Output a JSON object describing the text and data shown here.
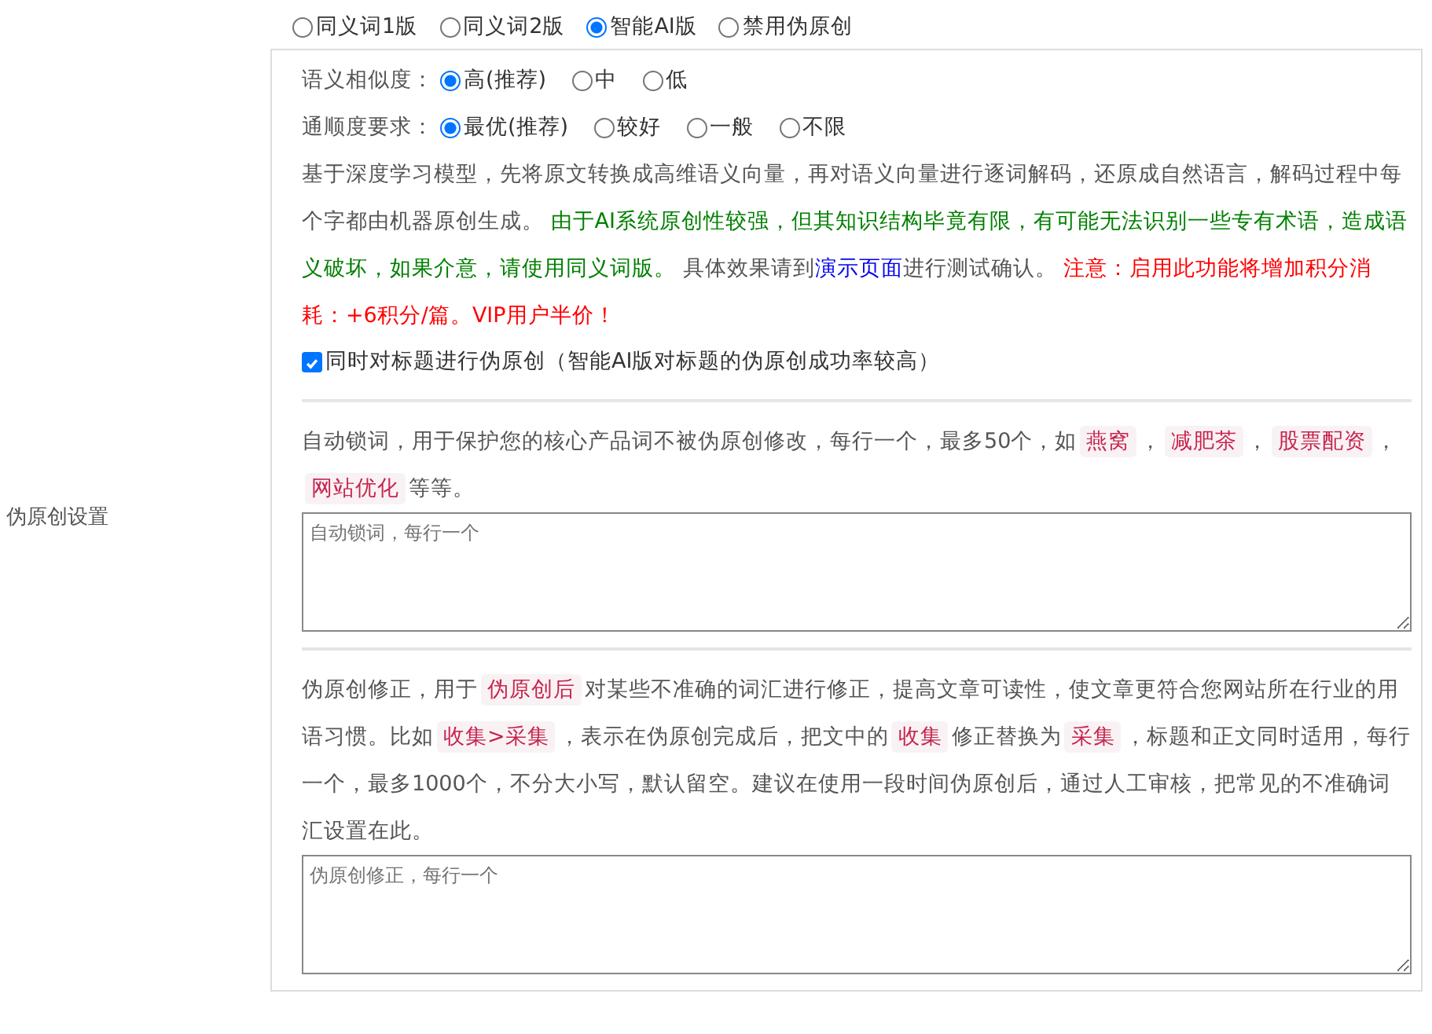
{
  "mode_options": [
    {
      "label": "同义词1版",
      "selected": false
    },
    {
      "label": "同义词2版",
      "selected": false
    },
    {
      "label": "智能AI版",
      "selected": true
    },
    {
      "label": "禁用伪原创",
      "selected": false
    }
  ],
  "similarity": {
    "label": "语义相似度：",
    "options": [
      {
        "label": "高(推荐)",
        "selected": true
      },
      {
        "label": "中",
        "selected": false
      },
      {
        "label": "低",
        "selected": false
      }
    ]
  },
  "fluency": {
    "label": "通顺度要求：",
    "options": [
      {
        "label": "最优(推荐)",
        "selected": true
      },
      {
        "label": "较好",
        "selected": false
      },
      {
        "label": "一般",
        "selected": false
      },
      {
        "label": "不限",
        "selected": false
      }
    ]
  },
  "description": [
    {
      "kind": "plain",
      "text": "基于深度学习模型，先将原文转换成高维语义向量，再对语义向量进行逐词解码，还原成自然语言，解码过程中每个字都由机器原创生成。 "
    },
    {
      "kind": "green",
      "text": "由于AI系统原创性较强，但其知识结构毕竟有限，有可能无法识别一些专有术语，造成语义破坏，如果介意，请使用同义词版。"
    },
    {
      "kind": "plain",
      "text": " 具体效果请到"
    },
    {
      "kind": "link",
      "text": "演示页面"
    },
    {
      "kind": "plain",
      "text": "进行测试确认。 "
    },
    {
      "kind": "red",
      "text": "注意：启用此功能将增加积分消耗：+6积分/篇。VIP用户半价！"
    }
  ],
  "title_option": {
    "label": "同时对标题进行伪原创（智能AI版对标题的伪原创成功率较高）",
    "checked": true
  },
  "side_label": "伪原创设置",
  "lock_words": {
    "help": [
      {
        "kind": "plain",
        "text": "自动锁词，用于保护您的核心产品词不被伪原创修改，每行一个，最多50个，如"
      },
      {
        "kind": "tag",
        "text": "燕窝"
      },
      {
        "kind": "plain",
        "text": "，"
      },
      {
        "kind": "tag",
        "text": "减肥茶"
      },
      {
        "kind": "plain",
        "text": "，"
      },
      {
        "kind": "tag",
        "text": "股票配资"
      },
      {
        "kind": "plain",
        "text": "，"
      },
      {
        "kind": "tag",
        "text": "网站优化"
      },
      {
        "kind": "plain",
        "text": "等等。"
      }
    ],
    "placeholder": "自动锁词，每行一个"
  },
  "corrections": {
    "help": [
      {
        "kind": "plain",
        "text": "伪原创修正，用于"
      },
      {
        "kind": "tag",
        "text": "伪原创后"
      },
      {
        "kind": "plain",
        "text": "对某些不准确的词汇进行修正，提高文章可读性，使文章更符合您网站所在行业的用语习惯。比如"
      },
      {
        "kind": "tag",
        "text": "收集>采集"
      },
      {
        "kind": "plain",
        "text": "，表示在伪原创完成后，把文中的"
      },
      {
        "kind": "tag",
        "text": "收集"
      },
      {
        "kind": "plain",
        "text": "修正替换为"
      },
      {
        "kind": "tag",
        "text": "采集"
      },
      {
        "kind": "plain",
        "text": "，标题和正文同时适用，每行一个，最多1000个，不分大小写，默认留空。建议在使用一段时间伪原创后，通过人工审核，把常见的不准确词汇设置在此。"
      }
    ],
    "placeholder": "伪原创修正，每行一个"
  }
}
